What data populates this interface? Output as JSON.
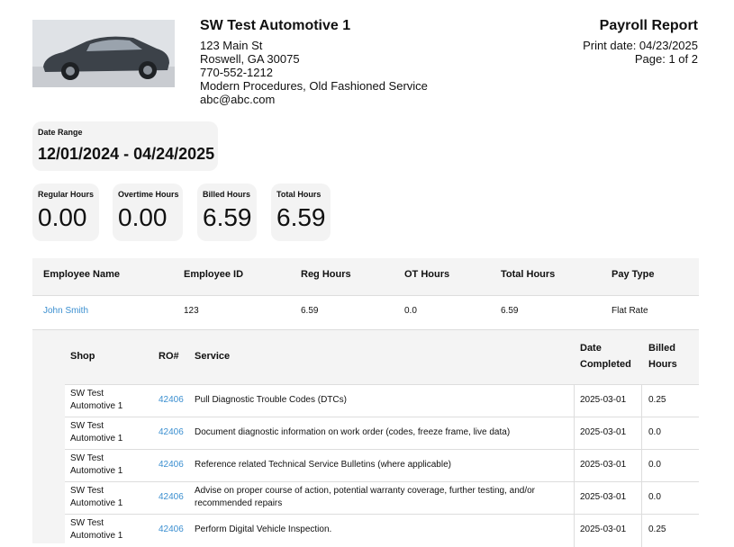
{
  "company": {
    "name": "SW Test Automotive 1",
    "address1": "123 Main St",
    "address2": "Roswell, GA 30075",
    "phone": "770-552-1212",
    "tagline": "Modern Procedures, Old Fashioned Service",
    "email": "abc@abc.com"
  },
  "report": {
    "title": "Payroll Report",
    "print_date": "Print date: 04/23/2025",
    "page": "Page: 1 of 2"
  },
  "date_range": {
    "label": "Date Range",
    "value": "12/01/2024 - 04/24/2025"
  },
  "summary": [
    {
      "label": "Regular Hours",
      "value": "0.00"
    },
    {
      "label": "Overtime Hours",
      "value": "0.00"
    },
    {
      "label": "Billed Hours",
      "value": "6.59"
    },
    {
      "label": "Total Hours",
      "value": "6.59"
    }
  ],
  "employee_table": {
    "headers": [
      "Employee Name",
      "Employee ID",
      "Reg Hours",
      "OT Hours",
      "Total Hours",
      "Pay Type"
    ],
    "row": {
      "name": "John Smith",
      "id": "123",
      "reg": "6.59",
      "ot": "0.0",
      "total": "6.59",
      "pay_type": "Flat Rate"
    }
  },
  "detail_table": {
    "headers": {
      "shop": "Shop",
      "ro": "RO#",
      "service": "Service",
      "date_line1": "Date",
      "date_line2": "Completed",
      "billed_line1": "Billed",
      "billed_line2": "Hours"
    },
    "rows": [
      {
        "shop1": "SW Test",
        "shop2": "Automotive 1",
        "ro": "42406",
        "service1": "Pull Diagnostic Trouble Codes (DTCs)",
        "service2": "",
        "date": "2025-03-01",
        "billed": "0.25"
      },
      {
        "shop1": "SW Test",
        "shop2": "Automotive 1",
        "ro": "42406",
        "service1": "Document diagnostic information on work order (codes, freeze frame, live data)",
        "service2": "",
        "date": "2025-03-01",
        "billed": "0.0"
      },
      {
        "shop1": "SW Test",
        "shop2": "Automotive 1",
        "ro": "42406",
        "service1": "Reference related Technical Service Bulletins (where applicable)",
        "service2": "",
        "date": "2025-03-01",
        "billed": "0.0"
      },
      {
        "shop1": "SW Test",
        "shop2": "Automotive 1",
        "ro": "42406",
        "service1": "Advise on proper course of action, potential warranty coverage, further testing, and/or",
        "service2": "recommended repairs",
        "date": "2025-03-01",
        "billed": "0.0"
      },
      {
        "shop1": "SW Test",
        "shop2": "Automotive 1",
        "ro": "42406",
        "service1": "Perform Digital Vehicle Inspection.",
        "service2": "",
        "date": "2025-03-01",
        "billed": "0.25"
      }
    ]
  }
}
